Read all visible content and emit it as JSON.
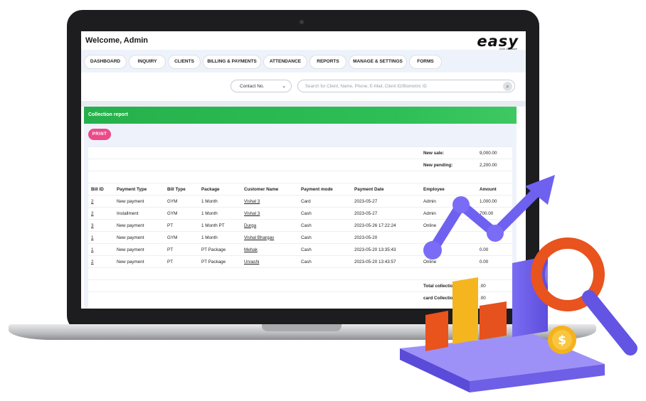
{
  "header": {
    "welcome": "Welcome, Admin",
    "logo": "easy",
    "logo_sub": "Gym Software"
  },
  "nav": [
    "DASHBOARD",
    "INQUIRY",
    "CLIENTS",
    "BILLING & PAYMENTS",
    "ATTENDANCE",
    "REPORTS",
    "MANAGE & SETTINGS",
    "FORMS"
  ],
  "search": {
    "select_value": "Contact No.",
    "placeholder": "Search for Client, Name, Phone, E-Mail, Client ID/Biometric ID"
  },
  "report": {
    "title": "Collection report",
    "print_label": "PRINT"
  },
  "summary_top": [
    {
      "label": "New sale:",
      "value": "9,000.00"
    },
    {
      "label": "New pending:",
      "value": "2,200.00"
    }
  ],
  "columns": [
    "Bill ID",
    "Payment Type",
    "Bill Type",
    "Package",
    "Customer Name",
    "Payment mode",
    "Payment Date",
    "Employee",
    "Amount"
  ],
  "rows": [
    [
      "2",
      "New payment",
      "GYM",
      "1 Month",
      "Vishal 3",
      "Card",
      "2023-05-27",
      "Admin",
      "1,000.00"
    ],
    [
      "2",
      "Installment",
      "GYM",
      "1 Month",
      "Vishal 3",
      "Cash",
      "2023-05-27",
      "Admin",
      "700.00"
    ],
    [
      "3",
      "New payment",
      "PT",
      "1 Month PT",
      "Durga",
      "Cash",
      "2023-05-26 17:22:24",
      "Online",
      ""
    ],
    [
      "1",
      "New payment",
      "GYM",
      "1 Month",
      "Vishal Bhargav",
      "Cash",
      "2023-05-20",
      "",
      ""
    ],
    [
      "1",
      "New payment",
      "PT",
      "PT Package",
      "Mehak",
      "Cash",
      "2023-05-20 13:35:43",
      "",
      "0.00"
    ],
    [
      "2",
      "New payment",
      "PT",
      "PT Package",
      "Urvashi",
      "Cash",
      "2023-05-20 13:43:57",
      "Online",
      "0.00"
    ]
  ],
  "summary_bottom": [
    {
      "label": "Total collectio",
      "value": ".00"
    },
    {
      "label": "card Collectio",
      "value": ".00"
    }
  ],
  "colors": {
    "green": "#2dbf55",
    "print": "#ec4a89",
    "purple": "#6b5cf0",
    "orange": "#e65a1f"
  }
}
